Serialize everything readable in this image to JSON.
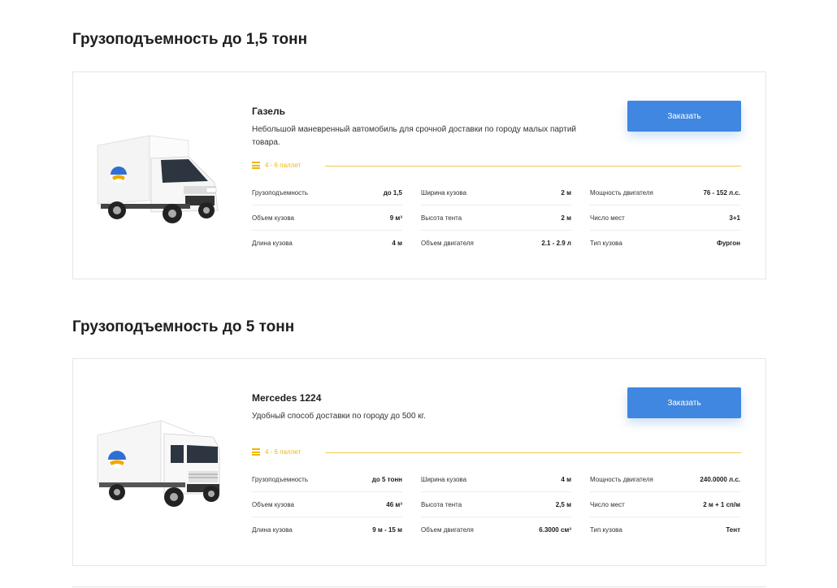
{
  "sections": [
    {
      "title": "Грузоподъемность до 1,5 тонн",
      "vehicle": {
        "name": "Газель",
        "description": "Небольшой маневренный автомобиль для срочной доставки по городу малых партий товара.",
        "order_label": "Заказать",
        "pallets": "4 - 6 паллет",
        "specs": [
          [
            {
              "label": "Грузоподъемность",
              "value": "до 1,5"
            },
            {
              "label": "Объем кузова",
              "value": "9 м³"
            },
            {
              "label": "Длина кузова",
              "value": "4 м"
            }
          ],
          [
            {
              "label": "Ширина кузова",
              "value": "2 м"
            },
            {
              "label": "Высота тента",
              "value": "2 м"
            },
            {
              "label": "Объем двигателя",
              "value": "2.1 - 2.9 л"
            }
          ],
          [
            {
              "label": "Мощность двигателя",
              "value": "76 - 152 л.с."
            },
            {
              "label": "Число мест",
              "value": "3+1"
            },
            {
              "label": "Тип кузова",
              "value": "Фургон"
            }
          ]
        ]
      }
    },
    {
      "title": "Грузоподъемность до 5 тонн",
      "vehicle": {
        "name": "Mercedes 1224",
        "description": "Удобный способ доставки по городу до 500 кг.",
        "order_label": "Заказать",
        "pallets": "4 - 6 паллет",
        "specs": [
          [
            {
              "label": "Грузоподъемность",
              "value": "до 5 тонн"
            },
            {
              "label": "Объем кузова",
              "value": "46 м³"
            },
            {
              "label": "Длина кузова",
              "value": "9 м - 15 м"
            }
          ],
          [
            {
              "label": "Ширина кузова",
              "value": "4 м"
            },
            {
              "label": "Высота тента",
              "value": "2,5 м"
            },
            {
              "label": "Объем двигателя",
              "value": "6.3000 см³"
            }
          ],
          [
            {
              "label": "Мощность двигателя",
              "value": "240.0000 л.с."
            },
            {
              "label": "Число мест",
              "value": "2 м + 1 сп/м"
            },
            {
              "label": "Тип кузова",
              "value": "Тент"
            }
          ]
        ]
      }
    }
  ],
  "colors": {
    "accent": "#3f87e0",
    "pallet": "#f2b705",
    "border": "#e6e6e6"
  },
  "icons": [
    "truck-van-image",
    "truck-lorry-image",
    "pallet-icon"
  ]
}
